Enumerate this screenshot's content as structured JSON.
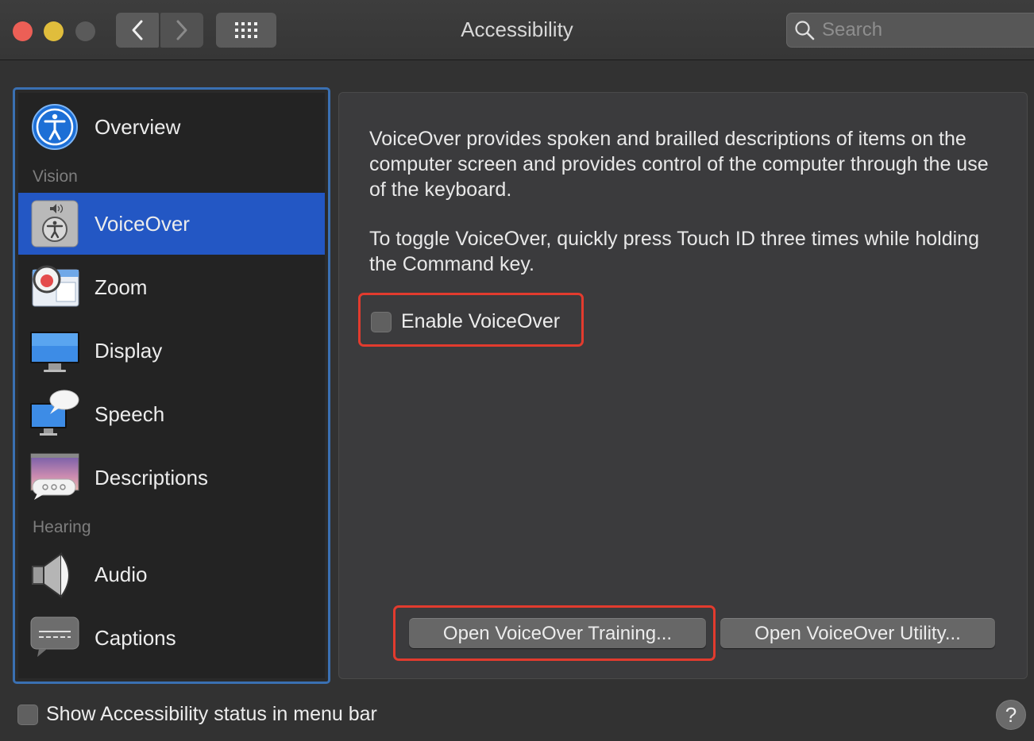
{
  "window": {
    "title": "Accessibility",
    "search_placeholder": "Search"
  },
  "toolbar": {
    "back_icon": "chevron-left-icon",
    "forward_icon": "chevron-right-icon",
    "grid_icon": "show-all-grid-icon"
  },
  "sidebar": {
    "overview": {
      "label": "Overview",
      "icon": "accessibility-overview-icon"
    },
    "section_vision": "Vision",
    "voiceover": {
      "label": "VoiceOver",
      "icon": "voiceover-icon",
      "selected": true
    },
    "zoom": {
      "label": "Zoom",
      "icon": "zoom-icon"
    },
    "display": {
      "label": "Display",
      "icon": "display-icon"
    },
    "speech": {
      "label": "Speech",
      "icon": "speech-icon"
    },
    "descriptions": {
      "label": "Descriptions",
      "icon": "descriptions-icon"
    },
    "section_hearing": "Hearing",
    "audio": {
      "label": "Audio",
      "icon": "audio-speaker-icon"
    },
    "captions": {
      "label": "Captions",
      "icon": "captions-icon"
    }
  },
  "content": {
    "description_1": "VoiceOver provides spoken and brailled descriptions of items on the computer screen and provides control of the computer through the use of the keyboard.",
    "description_2": "To toggle VoiceOver, quickly press Touch ID three times while holding the Command key.",
    "enable_voiceover_label": "Enable VoiceOver",
    "enable_voiceover_checked": false,
    "training_button": "Open VoiceOver Training...",
    "utility_button": "Open VoiceOver Utility..."
  },
  "footer": {
    "show_status_label": "Show Accessibility status in menu bar",
    "show_status_checked": false,
    "help_label": "?"
  },
  "colors": {
    "selection": "#2357c4",
    "highlight": "#e23b2e",
    "focus_ring": "#3a70b2"
  }
}
